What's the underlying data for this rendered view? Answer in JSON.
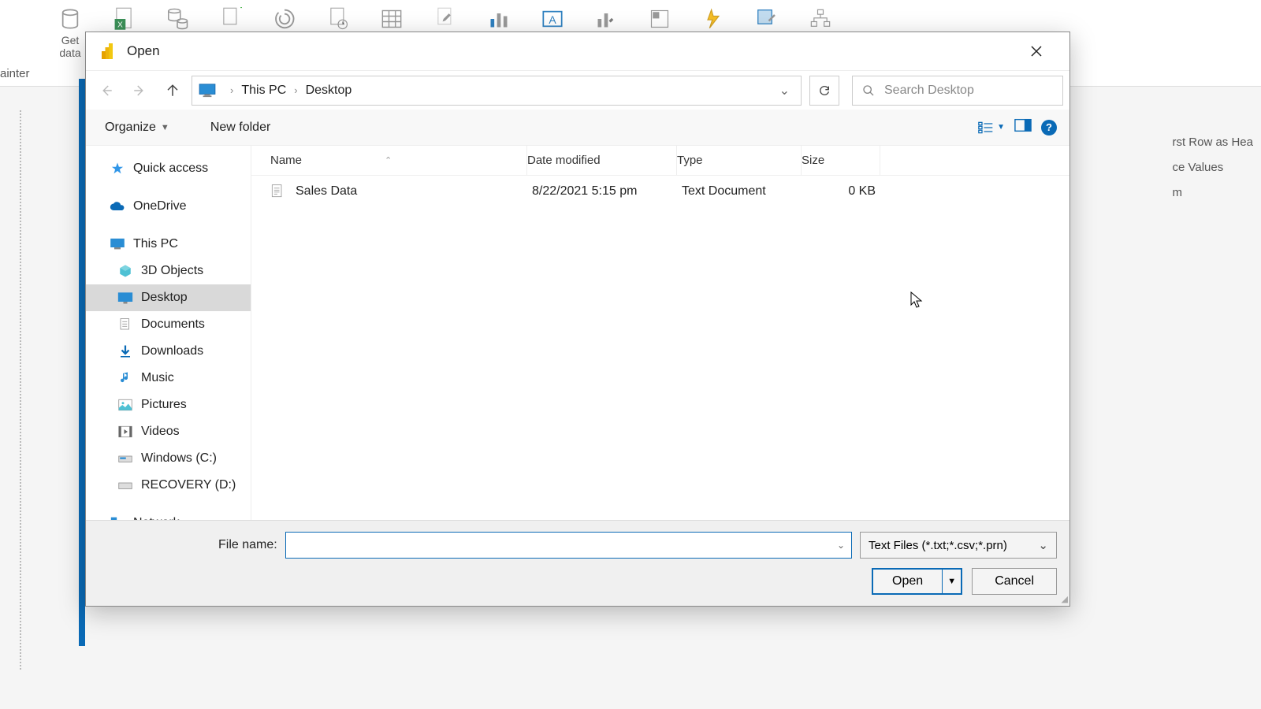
{
  "dialog": {
    "title": "Open",
    "filename_label": "File name:",
    "open_label": "Open",
    "cancel_label": "Cancel",
    "filter_label": "Text Files (*.txt;*.csv;*.prn)"
  },
  "toolbar": {
    "organize": "Organize",
    "new_folder": "New folder"
  },
  "search": {
    "placeholder": "Search Desktop"
  },
  "breadcrumb": {
    "root": "This PC",
    "current": "Desktop"
  },
  "background": {
    "get_data": "Get\ndata",
    "painter": "ainter",
    "first_row": "rst Row as Hea",
    "replace_values": "ce Values",
    "m": "m"
  },
  "tree": {
    "quick_access": "Quick access",
    "onedrive": "OneDrive",
    "this_pc": "This PC",
    "objects3d": "3D Objects",
    "desktop": "Desktop",
    "documents": "Documents",
    "downloads": "Downloads",
    "music": "Music",
    "pictures": "Pictures",
    "videos": "Videos",
    "windows_c": "Windows (C:)",
    "recovery_d": "RECOVERY (D:)",
    "network": "Network"
  },
  "headers": {
    "name": "Name",
    "date": "Date modified",
    "type": "Type",
    "size": "Size"
  },
  "files": [
    {
      "name": "Sales Data",
      "date": "8/22/2021 5:15 pm",
      "type": "Text Document",
      "size": "0 KB"
    }
  ]
}
